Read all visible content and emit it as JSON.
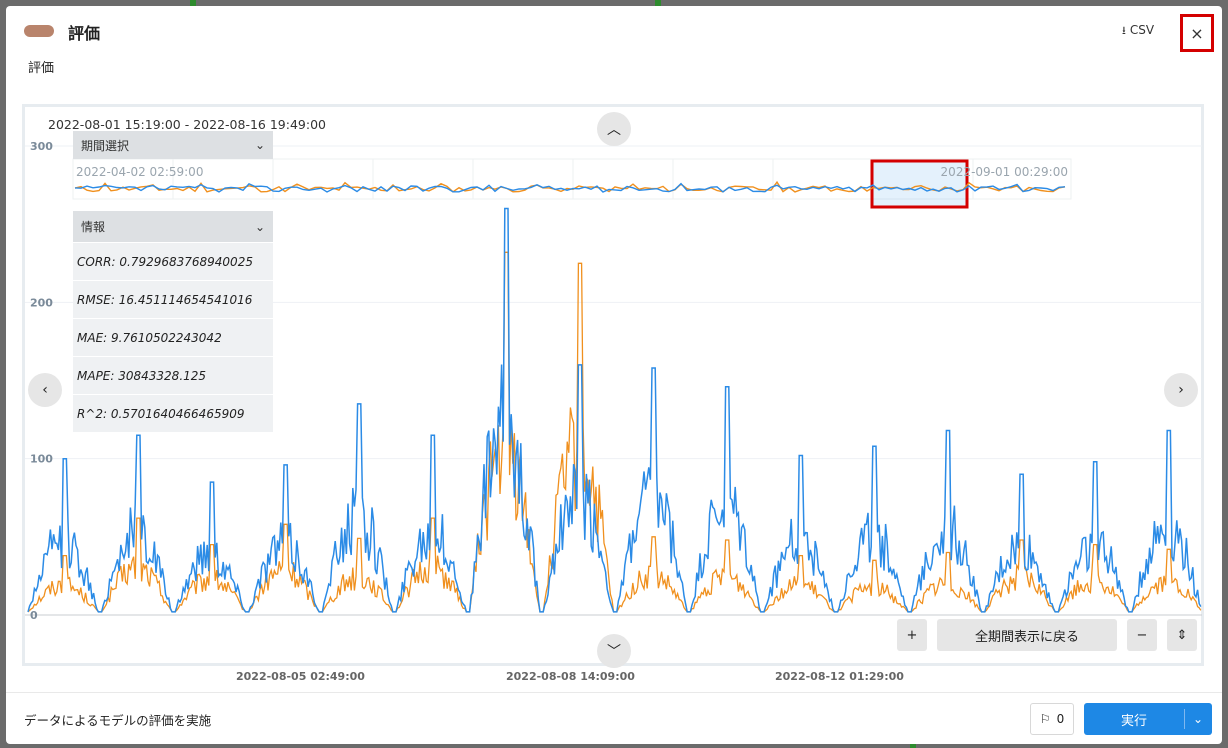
{
  "header": {
    "title": "評価",
    "csv_label": "CSV",
    "close_glyph": "×"
  },
  "subtitle": "評価",
  "chart": {
    "date_range": "2022-08-01 15:19:00 - 2022-08-16 19:49:00",
    "period_select_label": "期間選択",
    "navigator_start": "2022-04-02 02:59:00",
    "navigator_end": "2022-09-01 00:29:00",
    "info_label": "情報",
    "reset_label": "全期間表示に戻る",
    "plus_glyph": "+",
    "minus_glyph": "−",
    "fit_glyph": "⇕"
  },
  "metrics": [
    "CORR: 0.7929683768940025",
    "RMSE: 16.451114654541016",
    "MAE: 9.7610502243042",
    "MAPE: 30843328.125",
    "R^2: 0.5701640466465909"
  ],
  "chart_data": {
    "type": "line",
    "title": "",
    "x_ticks": [
      "2022-08-05 02:49:00",
      "2022-08-08 14:09:00",
      "2022-08-12 01:29:00"
    ],
    "y_ticks": [
      "300",
      "200",
      "100",
      "0"
    ],
    "ylim": [
      0,
      300
    ],
    "xlim": [
      "2022-08-01 15:19:00",
      "2022-08-16 19:49:00"
    ],
    "grid": true,
    "series": [
      {
        "color": "#f0901e",
        "daily_peaks": [
          38,
          62,
          45,
          58,
          49,
          62,
          232,
          225,
          50,
          48,
          38,
          35,
          40,
          48,
          45,
          42
        ]
      },
      {
        "color": "#2b8be6",
        "daily_peaks": [
          100,
          115,
          85,
          96,
          135,
          115,
          260,
          160,
          158,
          146,
          102,
          108,
          118,
          90,
          98,
          118
        ]
      }
    ]
  },
  "footer": {
    "description": "データによるモデルの評価を実施",
    "comment_count": "0",
    "run_label": "実行"
  },
  "colors": {
    "accent": "#1e88e5",
    "highlight": "#d40000",
    "orange_series": "#f0901e",
    "blue_series": "#2b8be6"
  }
}
